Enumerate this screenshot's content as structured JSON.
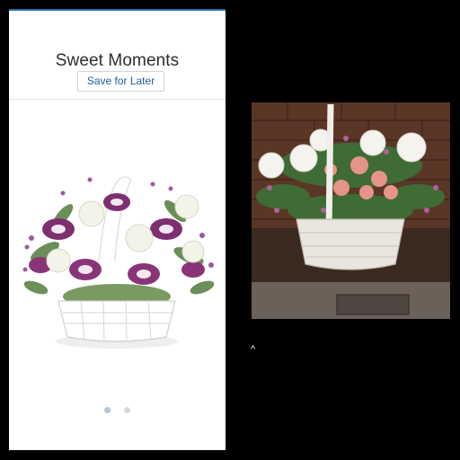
{
  "product_panel": {
    "title": "Sweet Moments",
    "save_label": "Save for Later",
    "carousel": {
      "slide_count": 2,
      "active_index": 0
    },
    "accent_color": "#2a6fb0"
  },
  "icons": {
    "product_image": "flower-basket-image",
    "photo": "flower-basket-photo"
  },
  "stray_text": "^"
}
